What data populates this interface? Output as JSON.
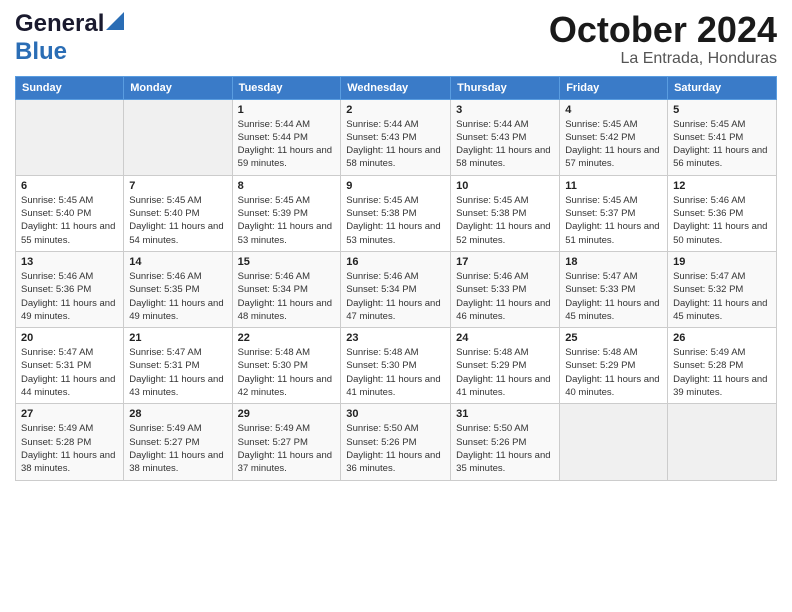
{
  "header": {
    "logo_line1": "General",
    "logo_line2": "Blue",
    "title": "October 2024",
    "subtitle": "La Entrada, Honduras"
  },
  "weekdays": [
    "Sunday",
    "Monday",
    "Tuesday",
    "Wednesday",
    "Thursday",
    "Friday",
    "Saturday"
  ],
  "weeks": [
    [
      {
        "day": "",
        "sunrise": "",
        "sunset": "",
        "daylight": ""
      },
      {
        "day": "",
        "sunrise": "",
        "sunset": "",
        "daylight": ""
      },
      {
        "day": "1",
        "sunrise": "Sunrise: 5:44 AM",
        "sunset": "Sunset: 5:44 PM",
        "daylight": "Daylight: 11 hours and 59 minutes."
      },
      {
        "day": "2",
        "sunrise": "Sunrise: 5:44 AM",
        "sunset": "Sunset: 5:43 PM",
        "daylight": "Daylight: 11 hours and 58 minutes."
      },
      {
        "day": "3",
        "sunrise": "Sunrise: 5:44 AM",
        "sunset": "Sunset: 5:43 PM",
        "daylight": "Daylight: 11 hours and 58 minutes."
      },
      {
        "day": "4",
        "sunrise": "Sunrise: 5:45 AM",
        "sunset": "Sunset: 5:42 PM",
        "daylight": "Daylight: 11 hours and 57 minutes."
      },
      {
        "day": "5",
        "sunrise": "Sunrise: 5:45 AM",
        "sunset": "Sunset: 5:41 PM",
        "daylight": "Daylight: 11 hours and 56 minutes."
      }
    ],
    [
      {
        "day": "6",
        "sunrise": "Sunrise: 5:45 AM",
        "sunset": "Sunset: 5:40 PM",
        "daylight": "Daylight: 11 hours and 55 minutes."
      },
      {
        "day": "7",
        "sunrise": "Sunrise: 5:45 AM",
        "sunset": "Sunset: 5:40 PM",
        "daylight": "Daylight: 11 hours and 54 minutes."
      },
      {
        "day": "8",
        "sunrise": "Sunrise: 5:45 AM",
        "sunset": "Sunset: 5:39 PM",
        "daylight": "Daylight: 11 hours and 53 minutes."
      },
      {
        "day": "9",
        "sunrise": "Sunrise: 5:45 AM",
        "sunset": "Sunset: 5:38 PM",
        "daylight": "Daylight: 11 hours and 53 minutes."
      },
      {
        "day": "10",
        "sunrise": "Sunrise: 5:45 AM",
        "sunset": "Sunset: 5:38 PM",
        "daylight": "Daylight: 11 hours and 52 minutes."
      },
      {
        "day": "11",
        "sunrise": "Sunrise: 5:45 AM",
        "sunset": "Sunset: 5:37 PM",
        "daylight": "Daylight: 11 hours and 51 minutes."
      },
      {
        "day": "12",
        "sunrise": "Sunrise: 5:46 AM",
        "sunset": "Sunset: 5:36 PM",
        "daylight": "Daylight: 11 hours and 50 minutes."
      }
    ],
    [
      {
        "day": "13",
        "sunrise": "Sunrise: 5:46 AM",
        "sunset": "Sunset: 5:36 PM",
        "daylight": "Daylight: 11 hours and 49 minutes."
      },
      {
        "day": "14",
        "sunrise": "Sunrise: 5:46 AM",
        "sunset": "Sunset: 5:35 PM",
        "daylight": "Daylight: 11 hours and 49 minutes."
      },
      {
        "day": "15",
        "sunrise": "Sunrise: 5:46 AM",
        "sunset": "Sunset: 5:34 PM",
        "daylight": "Daylight: 11 hours and 48 minutes."
      },
      {
        "day": "16",
        "sunrise": "Sunrise: 5:46 AM",
        "sunset": "Sunset: 5:34 PM",
        "daylight": "Daylight: 11 hours and 47 minutes."
      },
      {
        "day": "17",
        "sunrise": "Sunrise: 5:46 AM",
        "sunset": "Sunset: 5:33 PM",
        "daylight": "Daylight: 11 hours and 46 minutes."
      },
      {
        "day": "18",
        "sunrise": "Sunrise: 5:47 AM",
        "sunset": "Sunset: 5:33 PM",
        "daylight": "Daylight: 11 hours and 45 minutes."
      },
      {
        "day": "19",
        "sunrise": "Sunrise: 5:47 AM",
        "sunset": "Sunset: 5:32 PM",
        "daylight": "Daylight: 11 hours and 45 minutes."
      }
    ],
    [
      {
        "day": "20",
        "sunrise": "Sunrise: 5:47 AM",
        "sunset": "Sunset: 5:31 PM",
        "daylight": "Daylight: 11 hours and 44 minutes."
      },
      {
        "day": "21",
        "sunrise": "Sunrise: 5:47 AM",
        "sunset": "Sunset: 5:31 PM",
        "daylight": "Daylight: 11 hours and 43 minutes."
      },
      {
        "day": "22",
        "sunrise": "Sunrise: 5:48 AM",
        "sunset": "Sunset: 5:30 PM",
        "daylight": "Daylight: 11 hours and 42 minutes."
      },
      {
        "day": "23",
        "sunrise": "Sunrise: 5:48 AM",
        "sunset": "Sunset: 5:30 PM",
        "daylight": "Daylight: 11 hours and 41 minutes."
      },
      {
        "day": "24",
        "sunrise": "Sunrise: 5:48 AM",
        "sunset": "Sunset: 5:29 PM",
        "daylight": "Daylight: 11 hours and 41 minutes."
      },
      {
        "day": "25",
        "sunrise": "Sunrise: 5:48 AM",
        "sunset": "Sunset: 5:29 PM",
        "daylight": "Daylight: 11 hours and 40 minutes."
      },
      {
        "day": "26",
        "sunrise": "Sunrise: 5:49 AM",
        "sunset": "Sunset: 5:28 PM",
        "daylight": "Daylight: 11 hours and 39 minutes."
      }
    ],
    [
      {
        "day": "27",
        "sunrise": "Sunrise: 5:49 AM",
        "sunset": "Sunset: 5:28 PM",
        "daylight": "Daylight: 11 hours and 38 minutes."
      },
      {
        "day": "28",
        "sunrise": "Sunrise: 5:49 AM",
        "sunset": "Sunset: 5:27 PM",
        "daylight": "Daylight: 11 hours and 38 minutes."
      },
      {
        "day": "29",
        "sunrise": "Sunrise: 5:49 AM",
        "sunset": "Sunset: 5:27 PM",
        "daylight": "Daylight: 11 hours and 37 minutes."
      },
      {
        "day": "30",
        "sunrise": "Sunrise: 5:50 AM",
        "sunset": "Sunset: 5:26 PM",
        "daylight": "Daylight: 11 hours and 36 minutes."
      },
      {
        "day": "31",
        "sunrise": "Sunrise: 5:50 AM",
        "sunset": "Sunset: 5:26 PM",
        "daylight": "Daylight: 11 hours and 35 minutes."
      },
      {
        "day": "",
        "sunrise": "",
        "sunset": "",
        "daylight": ""
      },
      {
        "day": "",
        "sunrise": "",
        "sunset": "",
        "daylight": ""
      }
    ]
  ]
}
